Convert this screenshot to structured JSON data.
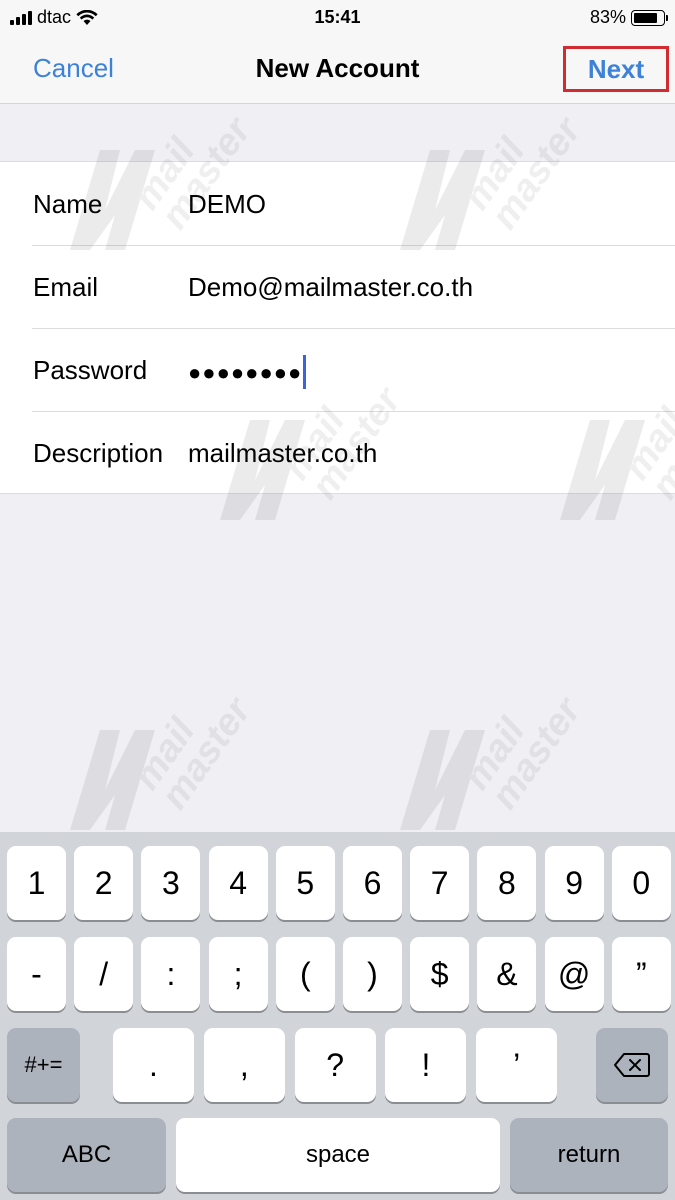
{
  "status_bar": {
    "carrier": "dtac",
    "time": "15:41",
    "battery_percent": "83%",
    "battery_level": 0.83
  },
  "nav": {
    "cancel_label": "Cancel",
    "title": "New Account",
    "next_label": "Next",
    "highlight_color": "#d22b32",
    "accent_color": "#3d82d8"
  },
  "form": {
    "fields": [
      {
        "label": "Name",
        "value": "DEMO"
      },
      {
        "label": "Email",
        "value": "Demo@mailmaster.co.th"
      },
      {
        "label": "Password",
        "value": "●●●●●●●●"
      },
      {
        "label": "Description",
        "value": "mailmaster.co.th"
      }
    ]
  },
  "watermark": {
    "line1": "mail",
    "line2": "master"
  },
  "keyboard": {
    "row1": [
      "1",
      "2",
      "3",
      "4",
      "5",
      "6",
      "7",
      "8",
      "9",
      "0"
    ],
    "row2": [
      "-",
      "/",
      ":",
      ";",
      "(",
      ")",
      "$",
      "&",
      "@",
      "”"
    ],
    "row3": [
      ".",
      ",",
      "?",
      "!",
      "’"
    ],
    "symbols_label": "#+=",
    "abc_label": "ABC",
    "space_label": "space",
    "return_label": "return"
  }
}
